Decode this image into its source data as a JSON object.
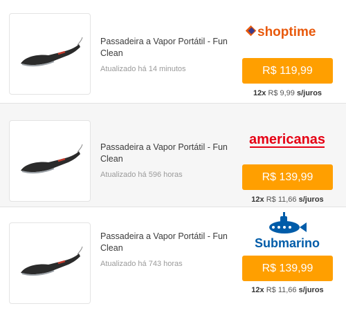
{
  "offers": [
    {
      "product_name": "Passadeira a Vapor Portátil - Fun Clean",
      "updated": "Atualizado há 14 minutos",
      "store": "shoptime",
      "price": "R$ 119,99",
      "installment_count": "12x",
      "installment_value": "R$ 9,99",
      "installment_terms": "s/juros"
    },
    {
      "product_name": "Passadeira a Vapor Portátil - Fun Clean",
      "updated": "Atualizado há 596 horas",
      "store": "americanas",
      "price": "R$ 139,99",
      "installment_count": "12x",
      "installment_value": "R$ 11,66",
      "installment_terms": "s/juros"
    },
    {
      "product_name": "Passadeira a Vapor Portátil - Fun Clean",
      "updated": "Atualizado há 743 horas",
      "store": "Submarino",
      "price": "R$ 139,99",
      "installment_count": "12x",
      "installment_value": "R$ 11,66",
      "installment_terms": "s/juros"
    }
  ],
  "colors": {
    "price_button": "#ff9f00",
    "shoptime": "#e8590c",
    "americanas": "#e60014",
    "submarino": "#005ca9"
  }
}
